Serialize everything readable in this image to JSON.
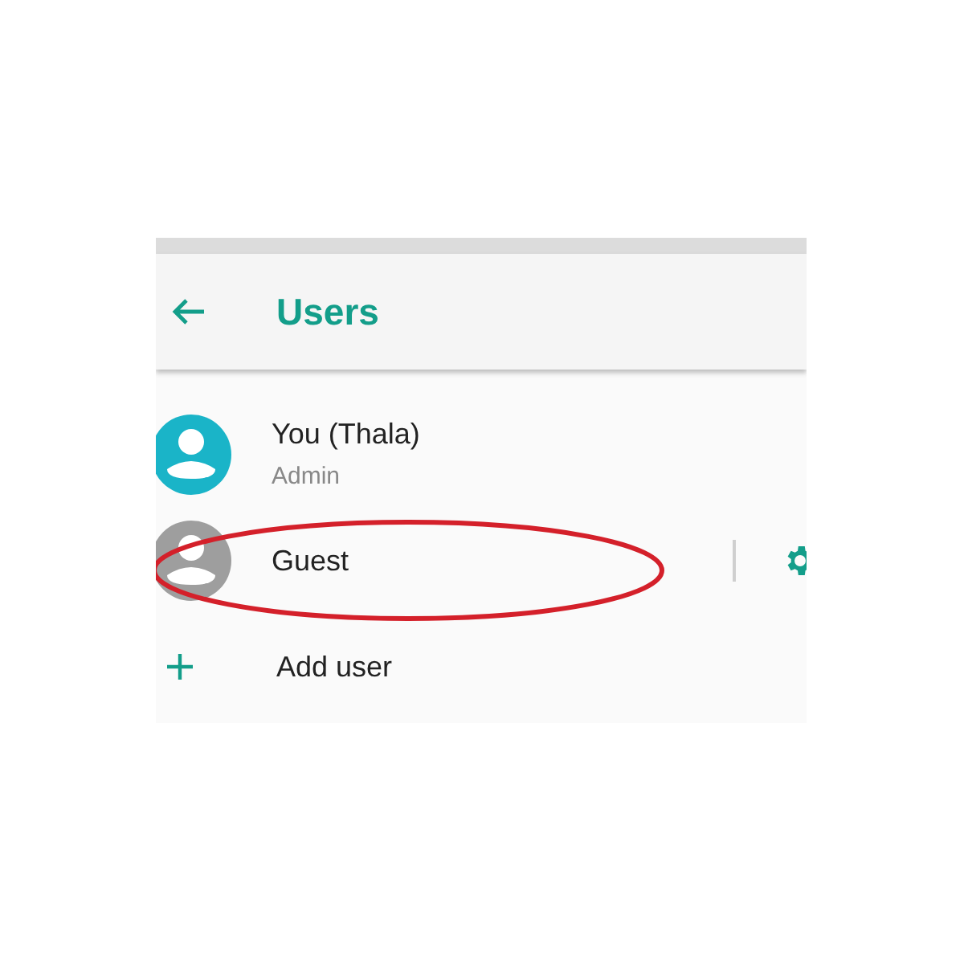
{
  "app_bar": {
    "title": "Users"
  },
  "users": [
    {
      "kind": "user",
      "name": "You (Thala)",
      "subtitle": "Admin",
      "color": "#1ab4c8",
      "settings": false
    },
    {
      "kind": "user",
      "name": "Guest",
      "color": "#9e9e9e",
      "settings": true
    },
    {
      "kind": "add",
      "name": "Add user"
    }
  ]
}
